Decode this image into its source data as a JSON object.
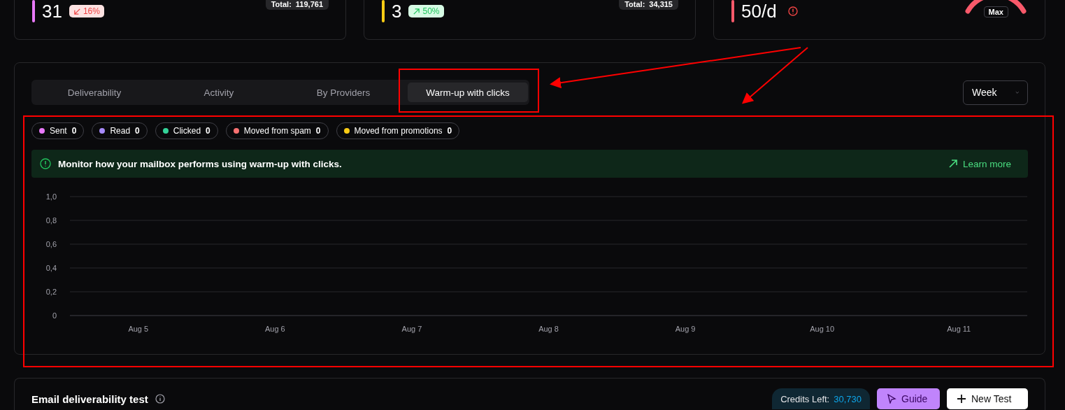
{
  "stat_cards": [
    {
      "kind": "trend",
      "color": "#e879f9",
      "value": "31",
      "badge": {
        "kind": "down",
        "text": "16%"
      },
      "total_label": "Total:",
      "total_value": "119,761"
    },
    {
      "kind": "trend",
      "color": "#facc15",
      "value": "3",
      "badge": {
        "kind": "up",
        "text": "50%"
      },
      "total_label": "Total:",
      "total_value": "34,315"
    },
    {
      "kind": "limit",
      "color": "#f8596a",
      "value": "50/d",
      "warning": true,
      "mode": "Max"
    }
  ],
  "chart_panel": {
    "tabs": [
      {
        "label": "Deliverability",
        "selected": false
      },
      {
        "label": "Activity",
        "selected": false
      },
      {
        "label": "By Providers",
        "selected": false
      },
      {
        "label": "Warm-up with clicks",
        "selected": true
      }
    ],
    "period": "Week",
    "legend": [
      {
        "label": "Sent",
        "count": "0",
        "color": "#e879f9"
      },
      {
        "label": "Read",
        "count": "0",
        "color": "#a78bfa"
      },
      {
        "label": "Clicked",
        "count": "0",
        "color": "#34d399"
      },
      {
        "label": "Moved from spam",
        "count": "0",
        "color": "#f87171"
      },
      {
        "label": "Moved from promotions",
        "count": "0",
        "color": "#facc15"
      }
    ],
    "notice": {
      "text": "Monitor how your mailbox performs using warm-up with clicks.",
      "link": "Learn more"
    },
    "chart_data": {
      "type": "line",
      "grid": true,
      "categories": [
        "Aug 5",
        "Aug 6",
        "Aug 7",
        "Aug 8",
        "Aug 9",
        "Aug 10",
        "Aug 11"
      ],
      "ylim": [
        0,
        1
      ],
      "yticks": [
        0,
        {
          "value": 0.2,
          "label": "0,2"
        },
        {
          "value": 0.4,
          "label": "0,4"
        },
        {
          "value": 0.6,
          "label": "0,6"
        },
        {
          "value": 0.8,
          "label": "0,8"
        },
        {
          "value": 1,
          "label": "1,0"
        }
      ]
    }
  },
  "test_panel": {
    "title": "Email deliverability test",
    "credits_label": "Credits Left:",
    "credits_value": "30,730",
    "buttons": [
      {
        "kind": "guide",
        "label": "Guide"
      },
      {
        "kind": "new",
        "label": "New Test"
      }
    ]
  }
}
